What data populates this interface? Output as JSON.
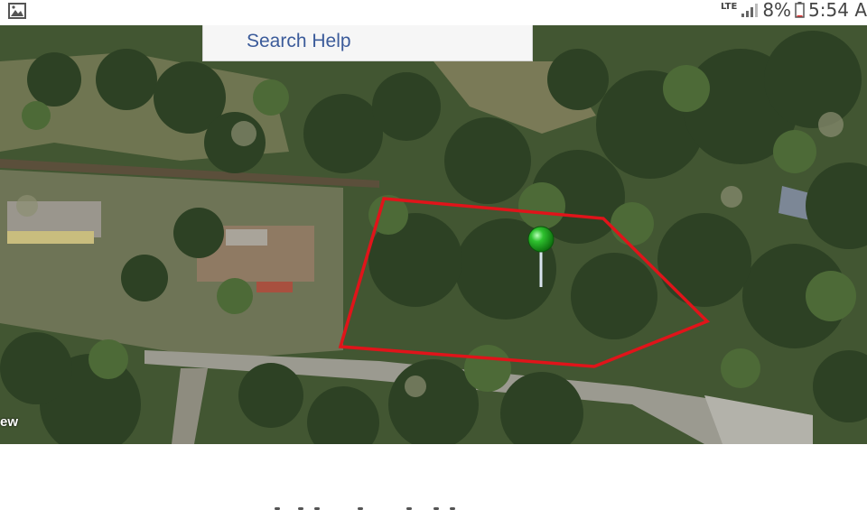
{
  "status_bar": {
    "left_icon": "image-icon",
    "network": "LTE",
    "battery_percent": "8%",
    "time": "5:54 A"
  },
  "map": {
    "type": "aerial-satellite",
    "search_label": "Search Help",
    "view_label": "ew",
    "parcel_outline_color": "#e0141a",
    "marker_color": "#2ec12e",
    "marker": "green-pushpin"
  }
}
